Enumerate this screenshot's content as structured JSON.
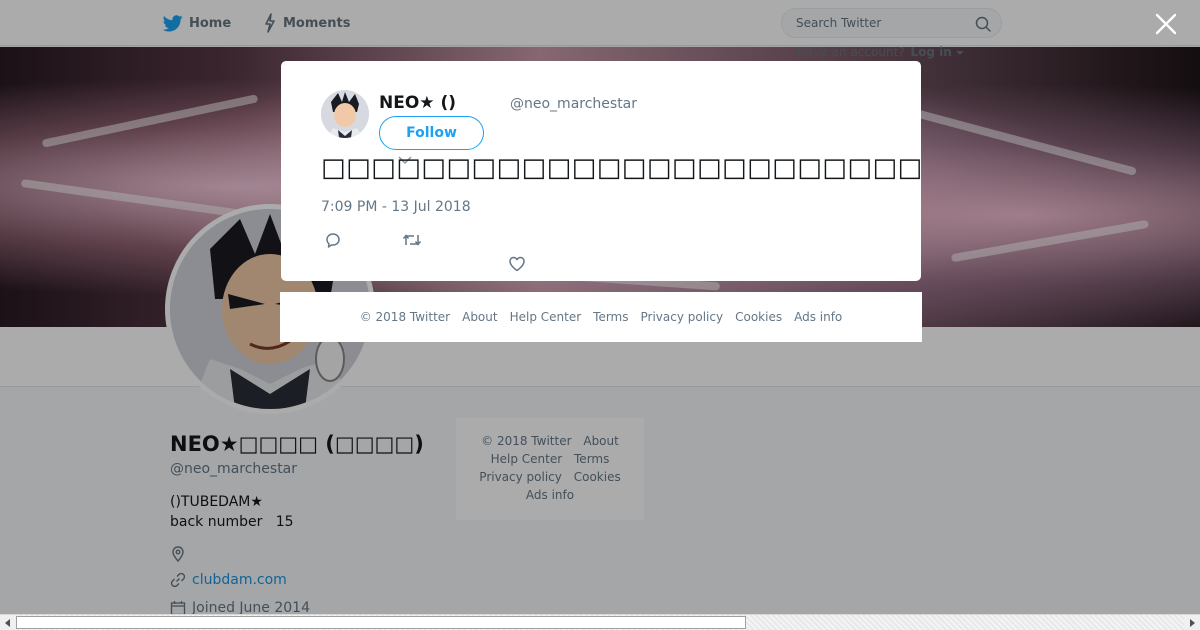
{
  "nav": {
    "home_label": "Home",
    "moments_label": "Moments",
    "search_placeholder": "Search Twitter",
    "account_prompt": "Have an account?",
    "login_label": "Log in"
  },
  "profile": {
    "name": "NEO★□□□□ (□□□□)",
    "handle": "@neo_marchestar",
    "bio_line1": "()TUBEDAM★",
    "bio_line2": "back number   15",
    "url": "clubdam.com",
    "joined": "Joined June 2014"
  },
  "side_footer": {
    "copyright": "© 2018 Twitter",
    "about": "About",
    "help": "Help Center",
    "terms": "Terms",
    "privacy": "Privacy policy",
    "cookies": "Cookies",
    "ads": "Ads info"
  },
  "tweet": {
    "author_name": "NEO★ ()",
    "author_handle": "@neo_marchestar",
    "follow_label": "Follow",
    "text": "□□□□□□□□□□□□□□□□□□□□□□□□□□□□□ □□□□□□□□□□□□□□□□ □□□□□□□□□□□□□□□",
    "timestamp": "7:09 PM - 13 Jul 2018"
  },
  "modal_footer": {
    "copyright": "© 2018 Twitter",
    "about": "About",
    "help": "Help Center",
    "terms": "Terms",
    "privacy": "Privacy policy",
    "cookies": "Cookies",
    "ads": "Ads info"
  },
  "icons": {
    "brand": "twitter-bird-icon",
    "moments": "lightning-icon",
    "search": "search-icon",
    "close": "close-icon",
    "reply": "reply-icon",
    "retweet": "retweet-icon",
    "like": "heart-icon",
    "location": "location-pin-icon",
    "link": "link-icon",
    "calendar": "calendar-icon"
  },
  "colors": {
    "accent": "#1da1f2",
    "link": "#1b95e0",
    "text": "#14171a",
    "muted": "#657786"
  }
}
